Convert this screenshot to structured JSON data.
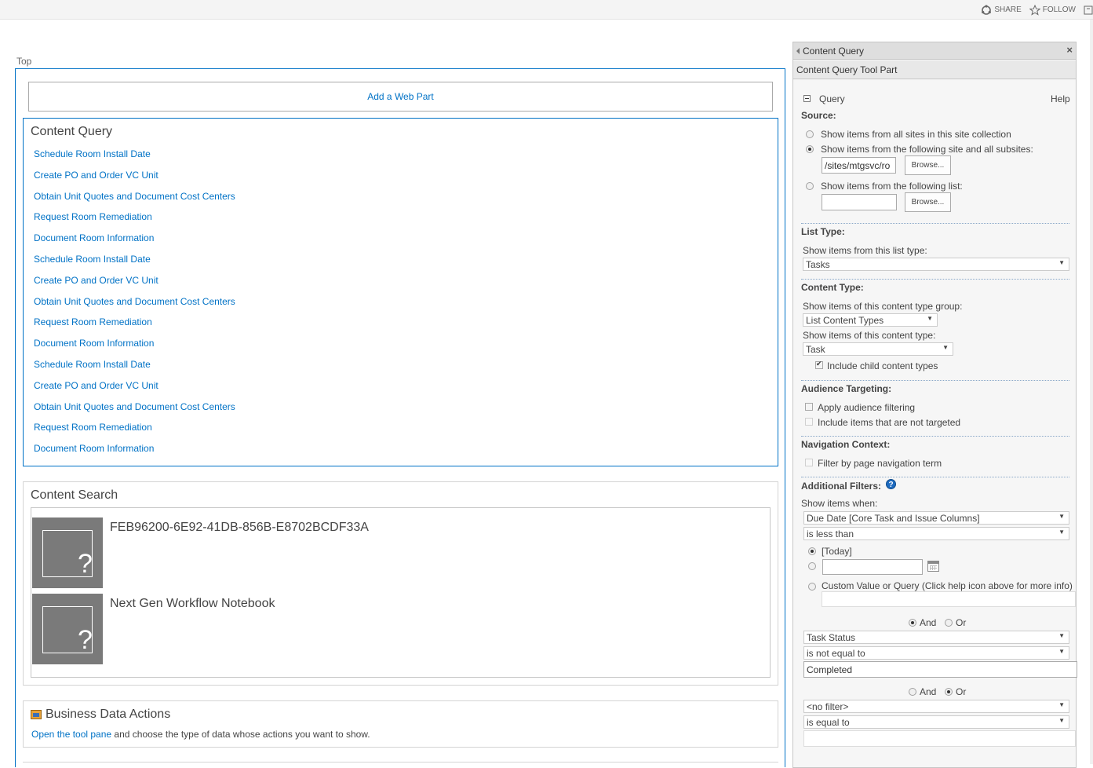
{
  "topbar": {
    "share_label": "SHARE",
    "follow_label": "FOLLOW",
    "icons": [
      "share-icon",
      "star-icon",
      "focus-icon"
    ]
  },
  "zone": {
    "title": "Top",
    "add_web_part": "Add a Web Part"
  },
  "content_query": {
    "title": "Content Query",
    "items": [
      "Schedule Room Install Date",
      "Create PO and Order VC Unit",
      "Obtain Unit Quotes and Document Cost Centers",
      "Request Room Remediation",
      "Document Room Information",
      "Schedule Room Install Date",
      "Create PO and Order VC Unit",
      "Obtain Unit Quotes and Document Cost Centers",
      "Request Room Remediation",
      "Document Room Information",
      "Schedule Room Install Date",
      "Create PO and Order VC Unit",
      "Obtain Unit Quotes and Document Cost Centers",
      "Request Room Remediation",
      "Document Room Information"
    ]
  },
  "content_search": {
    "title": "Content Search",
    "items": [
      {
        "title": "FEB96200-6E92-41DB-856B-E8702BCDF33A",
        "thumb_glyph": "?"
      },
      {
        "title": "Next Gen Workflow Notebook",
        "thumb_glyph": "?"
      }
    ]
  },
  "business_data_actions": {
    "title": "Business Data Actions",
    "link_text": "Open the tool pane",
    "rest_text": " and choose the type of data whose actions you want to show."
  },
  "tool_pane": {
    "header_title": "Content Query",
    "close_glyph": "×",
    "subtitle": "Content Query Tool Part",
    "query_label": "Query",
    "help_label": "Help",
    "source": {
      "heading": "Source:",
      "option_all": "Show items from all sites in this site collection",
      "option_site": "Show items from the following site and all subsites:",
      "site_value": "/sites/mtgsvc/ro",
      "browse_label": "Browse...",
      "option_list": "Show items from the following list:",
      "list_value": "",
      "browse_label_2": "Browse..."
    },
    "list_type": {
      "heading": "List Type:",
      "label": "Show items from this list type:",
      "selected": "Tasks"
    },
    "content_type": {
      "heading": "Content Type:",
      "group_label": "Show items of this content type group:",
      "group_selected": "List Content Types",
      "type_label": "Show items of this content type:",
      "type_selected": "Task",
      "include_child": "Include child content types"
    },
    "audience": {
      "heading": "Audience Targeting:",
      "apply_filtering": "Apply audience filtering",
      "include_not_targeted": "Include items that are not targeted"
    },
    "navigation": {
      "heading": "Navigation Context:",
      "filter_by_term": "Filter by page navigation term"
    },
    "filters": {
      "heading": "Additional Filters:",
      "help_glyph": "?",
      "show_when": "Show items when:",
      "filter1_field": "Due Date [Core Task and Issue Columns]",
      "filter1_op": "is less than",
      "today_label": "[Today]",
      "custom_label": "Custom Value or Query (Click help icon above for more info)",
      "and_label": "And",
      "or_label": "Or",
      "filter2_field": "Task Status",
      "filter2_op": "is not equal to",
      "filter2_value": "Completed",
      "and_label_2": "And",
      "or_label_2": "Or",
      "filter3_field": "<no filter>",
      "filter3_op": "is equal to"
    }
  }
}
